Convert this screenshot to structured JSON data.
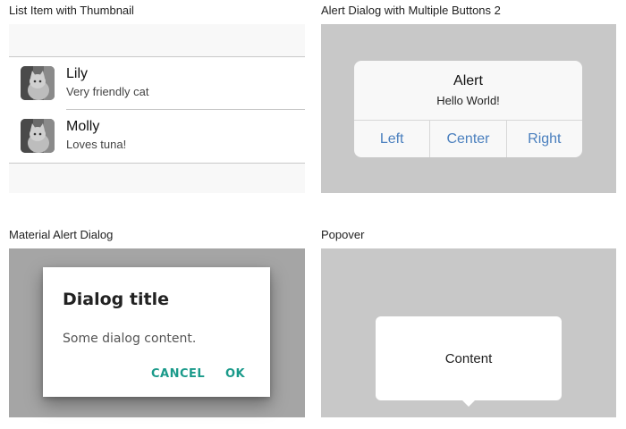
{
  "sections": {
    "list_thumbnail": {
      "title": "List Item with Thumbnail",
      "items": [
        {
          "title": "Lily",
          "subtitle": "Very friendly cat",
          "thumbnail": "cat-photo"
        },
        {
          "title": "Molly",
          "subtitle": "Loves tuna!",
          "thumbnail": "cat-photo"
        }
      ]
    },
    "alert_multi": {
      "title": "Alert Dialog with Multiple Buttons 2",
      "alert_title": "Alert",
      "alert_text": "Hello World!",
      "buttons": [
        "Left",
        "Center",
        "Right"
      ]
    },
    "material_alert": {
      "title": "Material Alert Dialog",
      "dialog_title": "Dialog title",
      "dialog_content": "Some dialog content.",
      "cancel_label": "CANCEL",
      "ok_label": "OK"
    },
    "popover": {
      "title": "Popover",
      "content": "Content"
    }
  },
  "colors": {
    "ios_link": "#4a7fbe",
    "material_accent": "#1a9a8a",
    "overlay_gray": "#c8c8c8",
    "material_overlay": "#a5a5a5"
  }
}
